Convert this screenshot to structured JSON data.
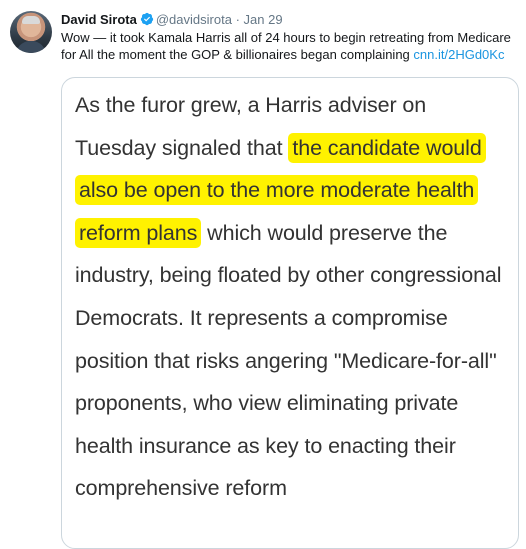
{
  "tweet": {
    "author_name": "David Sirota",
    "author_handle": "@davidsirota",
    "separator": "·",
    "date": "Jan 29",
    "text": "Wow — it took Kamala Harris all of 24 hours to begin retreating from Medicare for All the moment the GOP & billionaires began complaining ",
    "link": "cnn.it/2HGd0Kc",
    "icons": [
      "avatar",
      "verified-badge-icon"
    ],
    "colors": {
      "link": "#1b95e0",
      "verified": "#1da1f2",
      "highlight": "#fff200",
      "meta": "#657786"
    }
  },
  "media": {
    "before_highlight": "As the furor grew, a Harris adviser on Tuesday signaled that ",
    "highlight": "the candidate would also be open to the more moderate health reform plans",
    "after_highlight": " which would preserve the industry, being floated by other congressional Democrats. It represents a compromise position that risks angering \"Medicare-for-all\" proponents, who view eliminating private health insurance as key to enacting their comprehensive reform"
  }
}
